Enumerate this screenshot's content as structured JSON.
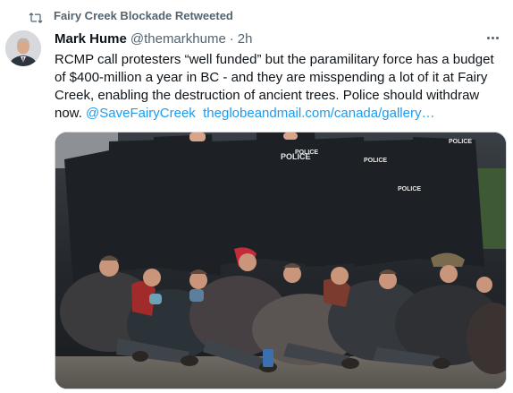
{
  "retweet": {
    "icon": "retweet-icon",
    "label": "Fairy Creek Blockade Retweeted"
  },
  "tweet": {
    "avatar_icon": "user-avatar",
    "name": "Mark Hume",
    "handle": "@themarkhume",
    "separator": "·",
    "time": "2h",
    "more_icon": "more-options-icon",
    "text": "RCMP call protesters “well funded” but the paramilitary force  has a budget of $400-million a year in BC - and they are misspending a lot of it at Fairy Creek, enabling the destruction of ancient trees. Police should withdraw now.",
    "hashtag": "@SaveFairyCreek",
    "link": "theglobeandmail.com/canada/gallery…",
    "media": {
      "description_icon": "protest-photo",
      "vest_labels": [
        "POLICE",
        "POLICE",
        "POLICE",
        "POLICE",
        "POLICE"
      ]
    }
  },
  "colors": {
    "link": "#1d9bf0",
    "secondary": "#536471",
    "primary_text": "#0f1419"
  }
}
